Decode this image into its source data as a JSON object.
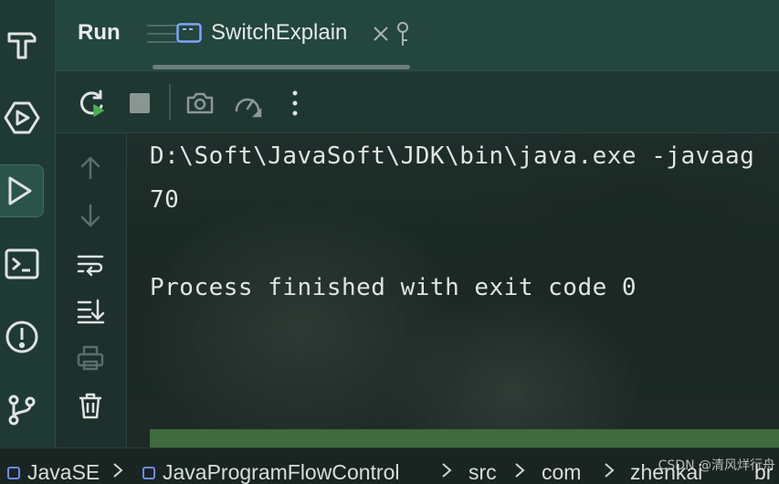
{
  "tool_window": {
    "title": "Run",
    "tab_label": "SwitchExplain"
  },
  "icons": {
    "activity_bar": [
      "build-hammer-icon",
      "services-icon",
      "run-icon",
      "terminal-icon",
      "problems-icon",
      "git-icon"
    ],
    "toolbar": [
      "rerun-icon",
      "stop-icon",
      "screenshot-icon",
      "profiler-icon",
      "more-icon"
    ],
    "gutter": [
      "scroll-up-icon",
      "scroll-down-icon",
      "soft-wrap-icon",
      "scroll-to-end-icon",
      "print-icon",
      "clear-icon"
    ]
  },
  "console": {
    "lines": [
      "D:\\Soft\\JavaSoft\\JDK\\bin\\java.exe -javaag",
      "70",
      "",
      "Process finished with exit code 0"
    ]
  },
  "breadcrumb": {
    "items": [
      "JavaSE",
      "JavaProgramFlowControl",
      "src",
      "com",
      "zhenkai",
      "br"
    ]
  },
  "watermark": "CSDN @清风烊行舟",
  "colors": {
    "accent_green": "#4caf50",
    "module_blue": "#6c8cf0",
    "scrollbar_green": "#3f6a3d"
  }
}
